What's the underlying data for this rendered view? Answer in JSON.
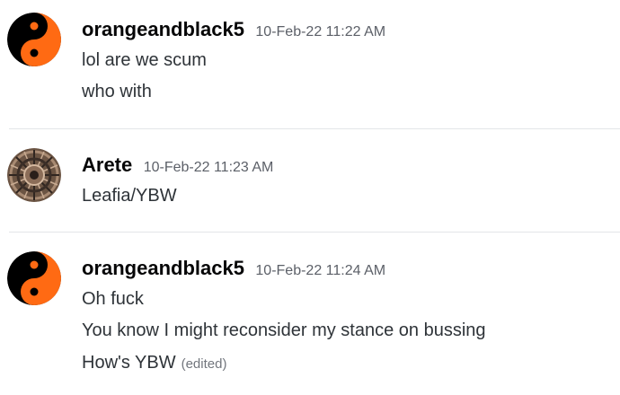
{
  "messages": [
    {
      "author": "orangeandblack5",
      "timestamp": "10-Feb-22 11:22 AM",
      "avatar_icon": "yin-yang-icon",
      "avatar_colors": {
        "light": "#ff6a13",
        "dark": "#000000"
      },
      "lines": [
        "lol are we scum",
        "who with"
      ]
    },
    {
      "author": "Arete",
      "timestamp": "10-Feb-22 11:23 AM",
      "avatar_icon": "mandala-icon",
      "lines": [
        "Leafia/YBW"
      ]
    },
    {
      "author": "orangeandblack5",
      "timestamp": "10-Feb-22 11:24 AM",
      "avatar_icon": "yin-yang-icon",
      "avatar_colors": {
        "light": "#ff6a13",
        "dark": "#000000"
      },
      "lines": [
        "Oh fuck",
        "You know I might reconsider my stance on bussing",
        "How's YBW"
      ],
      "edited_label": "(edited)"
    }
  ]
}
